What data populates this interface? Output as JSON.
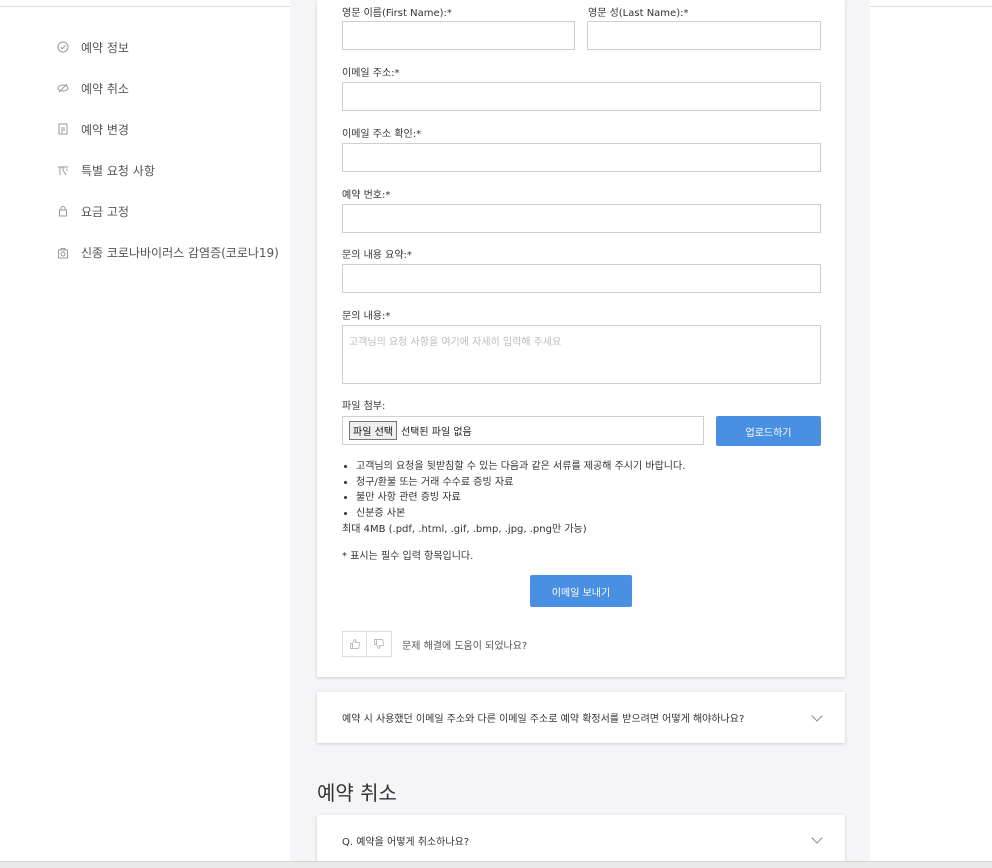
{
  "sidebar": {
    "items": [
      {
        "label": "예약 정보",
        "icon": "check-circle-icon"
      },
      {
        "label": "예약 취소",
        "icon": "cancel-icon"
      },
      {
        "label": "예약 변경",
        "icon": "document-edit-icon"
      },
      {
        "label": "특별 요청 사항",
        "icon": "special-request-icon"
      },
      {
        "label": "요금 고정",
        "icon": "lock-icon"
      },
      {
        "label": "신종 코로나바이러스 감염증(코로나19)",
        "icon": "virus-icon"
      }
    ]
  },
  "form": {
    "first_name_label": "영문 이름(First Name):*",
    "last_name_label": "영문 성(Last Name):*",
    "email_label": "이메일 주소:*",
    "email_confirm_label": "이메일 주소 확인:*",
    "booking_number_label": "예약 번호:*",
    "inquiry_summary_label": "문의 내용 요약:*",
    "inquiry_label": "문의 내용:*",
    "inquiry_placeholder": "고객님의 요청 사항을 여기에 자세히 입력해 주세요",
    "attachment_label": "파일 첨부:",
    "choose_file_button": "파일 선택",
    "no_file_text": "선택된 파일 없음",
    "upload_button": "업로드하기",
    "bullets": [
      "고객님의 요청을 뒷받침할 수 있는 다음과 같은 서류를 제공해 주시기 바랍니다.",
      "청구/환불 또는 거래 수수료 증빙 자료",
      "불만 사항 관련 증빙 자료",
      "신분증 사본"
    ],
    "max_size_text": "최대 4MB (.pdf, .html, .gif, .bmp, .jpg, .png만 가능)",
    "required_note": "* 표시는 필수 입력 항목입니다.",
    "send_button": "이메일 보내기",
    "feedback_text": "문제 해결에 도움이 되었나요?"
  },
  "faq_items": [
    {
      "text": "예약 시 사용했던 이메일 주소와 다른 이메일 주소로 예약 확정서를 받으려면 어떻게 해야하나요?"
    },
    {
      "text": "Q. 예약을 어떻게 취소하나요?"
    }
  ],
  "section_title": "예약 취소",
  "colors": {
    "accent": "#4a90e2",
    "background": "#f5f5f8"
  }
}
